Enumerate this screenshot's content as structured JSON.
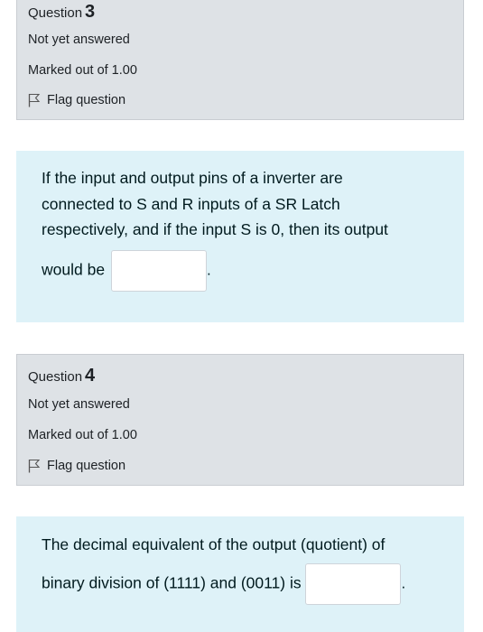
{
  "q3": {
    "label": "Question",
    "number": "3",
    "state": "Not yet answered",
    "grade": "Marked out of 1.00",
    "flag_label": "Flag question",
    "text_l1": "If the input and output pins of a inverter are",
    "text_l2": "connected to S and R inputs of a SR Latch",
    "text_l3": "respectively, and if the input S is 0, then its output",
    "text_l4": "would be",
    "answer_value": "",
    "after_answer": "."
  },
  "q4": {
    "label": "Question",
    "number": "4",
    "state": "Not yet answered",
    "grade": "Marked out of 1.00",
    "flag_label": "Flag question",
    "text_l1": "The decimal equivalent of the output (quotient) of",
    "text_l2": "binary division of (1111) and (0011) is",
    "answer_value": "",
    "after_answer": "."
  },
  "icons": {
    "flag": "flag-icon"
  },
  "colors": {
    "info_bg": "#dee2e6",
    "content_bg": "#def2f8"
  }
}
